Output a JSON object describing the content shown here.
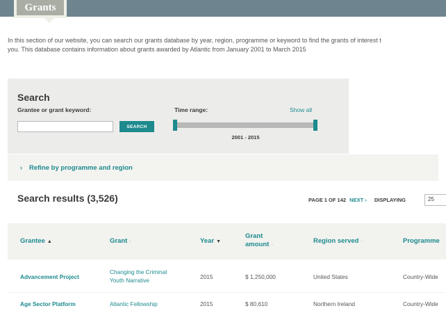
{
  "header": {
    "tab_label": "Grants"
  },
  "intro": {
    "line1": "In this section of our website, you can search our grants database by year, region, programme or keyword to find the grants of interest t",
    "line2": "you. This database contains information about grants awarded by Atlantic from January 2001 to March 2015"
  },
  "search": {
    "title": "Search",
    "keyword_label": "Grantee or grant keyword:",
    "keyword_value": "",
    "button_label": "SEARCH",
    "time_range_label": "Time range:",
    "show_all_label": "Show all",
    "range_value": "2001 - 2015"
  },
  "refine": {
    "chevron": "›",
    "label": "Refine by programme and region"
  },
  "results": {
    "title": "Search results (3,526)",
    "page_text": "PAGE 1 OF 142",
    "next_label": "NEXT ›",
    "displaying_label": "DISPLAYING",
    "per_page": "25"
  },
  "table": {
    "columns": [
      {
        "label": "Grantee",
        "sort": "▲"
      },
      {
        "label": "Grant",
        "sort": "-"
      },
      {
        "label": "Year",
        "sort": "▼"
      },
      {
        "label_line1": "Grant",
        "label_line2": "amount",
        "sort": "-"
      },
      {
        "label": "Region served",
        "sort": "-"
      },
      {
        "label": "Programme"
      }
    ],
    "rows": [
      {
        "grantee": "Advancement Project",
        "grant_line1": "Changing the Criminal",
        "grant_line2": "Youth Narrative",
        "year": "2015",
        "amount": "$ 1,250,000",
        "region": "United States",
        "programme": "Country-Wide"
      },
      {
        "grantee": "Age Sector Platform",
        "grant_line1": "Atlantic Fellowship",
        "year": "2015",
        "amount": "$ 80,610",
        "region": "Northern Ireland",
        "programme": "Country-Wide"
      }
    ]
  },
  "colors": {
    "accent": "#1d8a8e",
    "header_bar": "#6e858f",
    "panel": "#ececea"
  }
}
